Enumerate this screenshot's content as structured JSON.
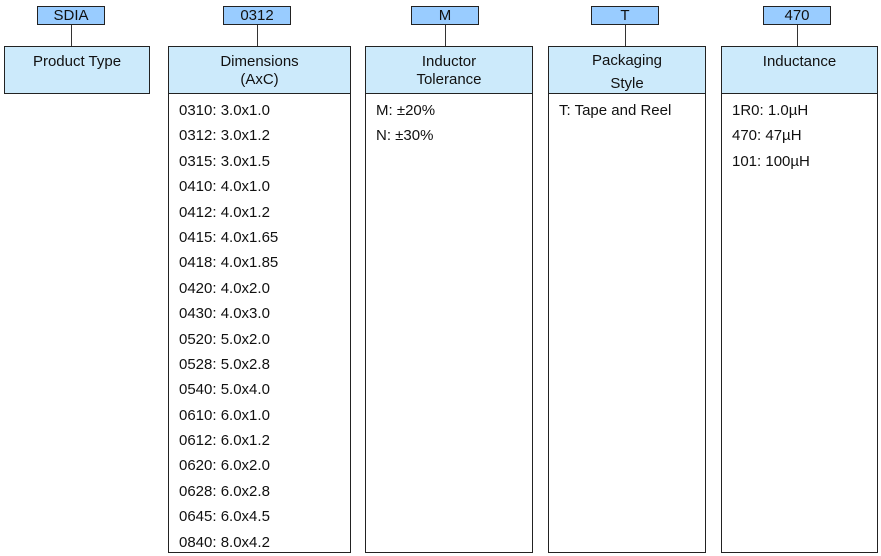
{
  "codes": [
    "SDIA",
    "0312",
    "M",
    "T",
    "470"
  ],
  "columns": [
    {
      "title": [
        "Product Type",
        ""
      ],
      "items": []
    },
    {
      "title": [
        "Dimensions",
        "(AxC)"
      ],
      "items": [
        "0310: 3.0x1.0",
        "0312: 3.0x1.2",
        "0315: 3.0x1.5",
        "0410: 4.0x1.0",
        "0412: 4.0x1.2",
        "0415: 4.0x1.65",
        "0418: 4.0x1.85",
        "0420: 4.0x2.0",
        "0430: 4.0x3.0",
        "0520: 5.0x2.0",
        "0528: 5.0x2.8",
        "0540: 5.0x4.0",
        "0610: 6.0x1.0",
        "0612: 6.0x1.2",
        "0620: 6.0x2.0",
        "0628: 6.0x2.8",
        "0645: 6.0x4.5",
        "0840: 8.0x4.2"
      ]
    },
    {
      "title": [
        "Inductor",
        "Tolerance"
      ],
      "items": [
        "M:  ±20%",
        "N:  ±30%"
      ]
    },
    {
      "title": [
        "Packaging",
        "Style"
      ],
      "items": [
        "T: Tape and Reel"
      ]
    },
    {
      "title": [
        "Inductance",
        ""
      ],
      "items": [
        "1R0: 1.0µH",
        "470: 47µH",
        "101: 100µH"
      ]
    }
  ],
  "colors": {
    "code_box": "#99ccff",
    "header": "#cceafb"
  }
}
